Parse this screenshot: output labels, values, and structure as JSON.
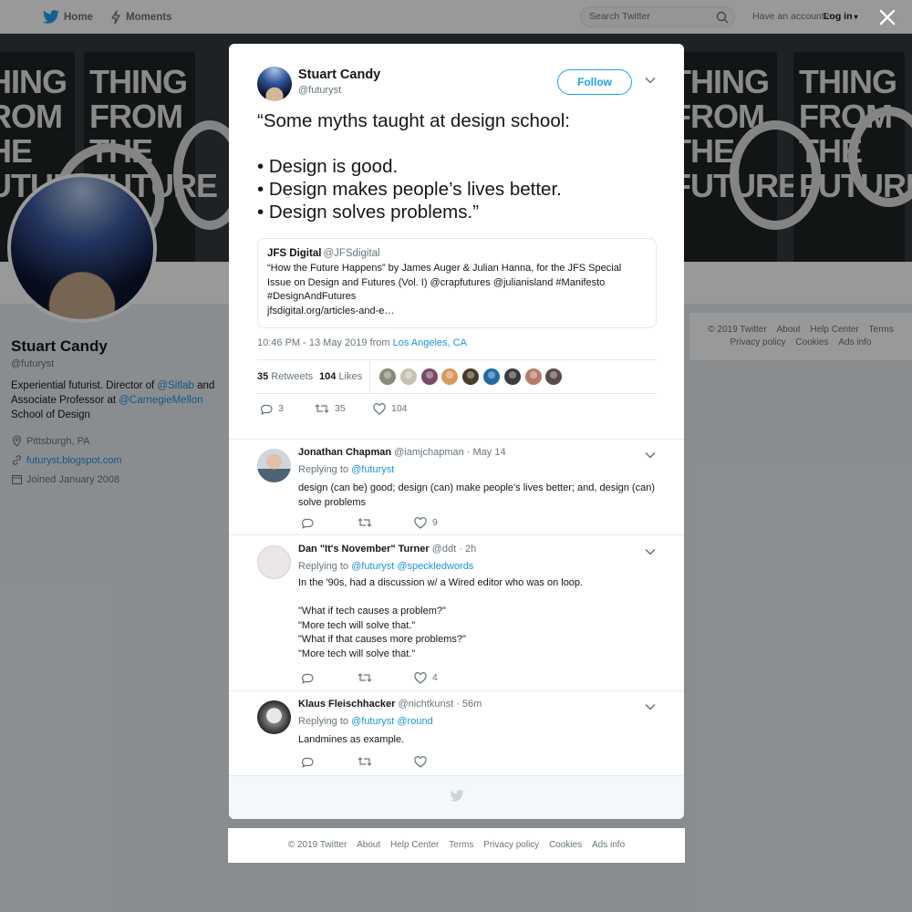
{
  "nav": {
    "home_label": "Home",
    "moments_label": "Moments",
    "search_placeholder": "Search Twitter",
    "have_account": "Have an account?",
    "login_label": "Log in"
  },
  "banner": {
    "book_lines": [
      "THING",
      "FROM THE",
      "FUTURE"
    ]
  },
  "profile": {
    "name": "Stuart Candy",
    "handle": "@futuryst",
    "bio_pre": "Experiential futurist. Director of ",
    "bio_link1": "@Sitlab",
    "bio_mid": " and Associate Professor at ",
    "bio_link2": "@CarnegieMellon",
    "bio_post": " School of Design",
    "location": "Pittsburgh, PA",
    "website": "futuryst.blogspot.com",
    "joined": "Joined January 2008"
  },
  "side_footer": {
    "links": [
      "© 2019 Twitter",
      "About",
      "Help Center",
      "Terms",
      "Privacy policy",
      "Cookies",
      "Ads info"
    ]
  },
  "tweet": {
    "author_name": "Stuart Candy",
    "author_handle": "@futuryst",
    "follow_label": "Follow",
    "text": "“Some myths taught at design school:\n\n• Design is good.\n• Design makes people’s lives better.\n• Design solves problems.”",
    "quote": {
      "name": "JFS Digital",
      "handle": "@JFSdigital",
      "text": "“How the Future Happens” by James Auger & Julian Hanna, for the JFS Special Issue on Design and Futures (Vol. I) @crapfutures @julianisland #Manifesto #DesignAndFutures",
      "link": "jfsdigital.org/articles-and-e…"
    },
    "time": "10:46 PM - 13 May 2019 from ",
    "location": "Los Angeles, CA",
    "retweets_count": "35",
    "retweets_label": " Retweets",
    "likes_count": "104",
    "likes_label": " Likes",
    "likers_colors": [
      "#8a8a7a",
      "#c9c0b5",
      "#7a4a6a",
      "#d89a5a",
      "#4a3a2a",
      "#1f6aa5",
      "#3a3a3a",
      "#b57a6a",
      "#5a4a4a"
    ],
    "action_replies": "3",
    "action_retweets": "35",
    "action_likes": "104"
  },
  "replies": [
    {
      "name": "Jonathan Chapman",
      "handle": "@iamjchapman",
      "date": " · May 14",
      "replying_prefix": "Replying to ",
      "replying_to": "@futuryst",
      "text": "design (can be) good; design (can) make people's lives better; and, design (can) solve problems",
      "likes": "9",
      "avatar_color": "#7b8a96"
    },
    {
      "name": "Dan \"It's November\" Turner",
      "handle": "@ddt",
      "date": " · 2h",
      "replying_prefix": "Replying to ",
      "replying_to": "@futuryst @speckledwords",
      "text": "In the '90s, had a discussion w/ a Wired editor who was on loop.\n\n\"What if tech causes a problem?\"\n\"More tech will solve that.\"\n\"What if that causes more problems?\"\n\"More tech will solve that.\"",
      "likes": "4",
      "avatar_color": "#e9e4e8"
    },
    {
      "name": "Klaus Fleischhacker",
      "handle": "@nichtkunst",
      "date": " · 56m",
      "replying_prefix": "Replying to ",
      "replying_to": "@futuryst @round",
      "text": "Landmines as example.",
      "likes": "",
      "avatar_color": "#2a2a2a"
    }
  ],
  "bottom_footer": {
    "links": [
      "© 2019 Twitter",
      "About",
      "Help Center",
      "Terms",
      "Privacy policy",
      "Cookies",
      "Ads info"
    ]
  },
  "colors": {
    "accent": "#1da1f2",
    "link": "#1b95e0",
    "muted": "#66757f"
  }
}
